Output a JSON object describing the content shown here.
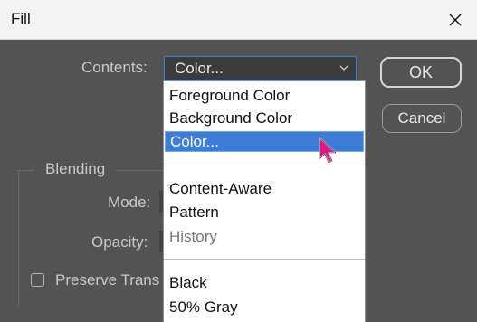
{
  "window": {
    "title": "Fill"
  },
  "form": {
    "contents_label": "Contents:",
    "contents_value": "Color...",
    "blending_label": "Blending",
    "mode_label": "Mode:",
    "opacity_label": "Opacity:",
    "preserve_label": "Preserve Trans"
  },
  "buttons": {
    "ok": "OK",
    "cancel": "Cancel"
  },
  "dropdown": {
    "items": [
      {
        "label": "Foreground Color"
      },
      {
        "label": "Background Color"
      },
      {
        "label": "Color...",
        "selected": true
      },
      {
        "label": "Content-Aware"
      },
      {
        "label": "Pattern"
      },
      {
        "label": "History",
        "disabled": true
      },
      {
        "label": "Black"
      },
      {
        "label": "50% Gray"
      }
    ]
  },
  "colors": {
    "dialog_bg": "#535353",
    "highlight": "#3c7dd9",
    "focus_border": "#2e83d8",
    "cursor": "#e0168a"
  },
  "icons": {
    "close": "close-icon",
    "dropdown_arrow": "chevron-down-icon",
    "cursor": "mouse-pointer-icon"
  }
}
